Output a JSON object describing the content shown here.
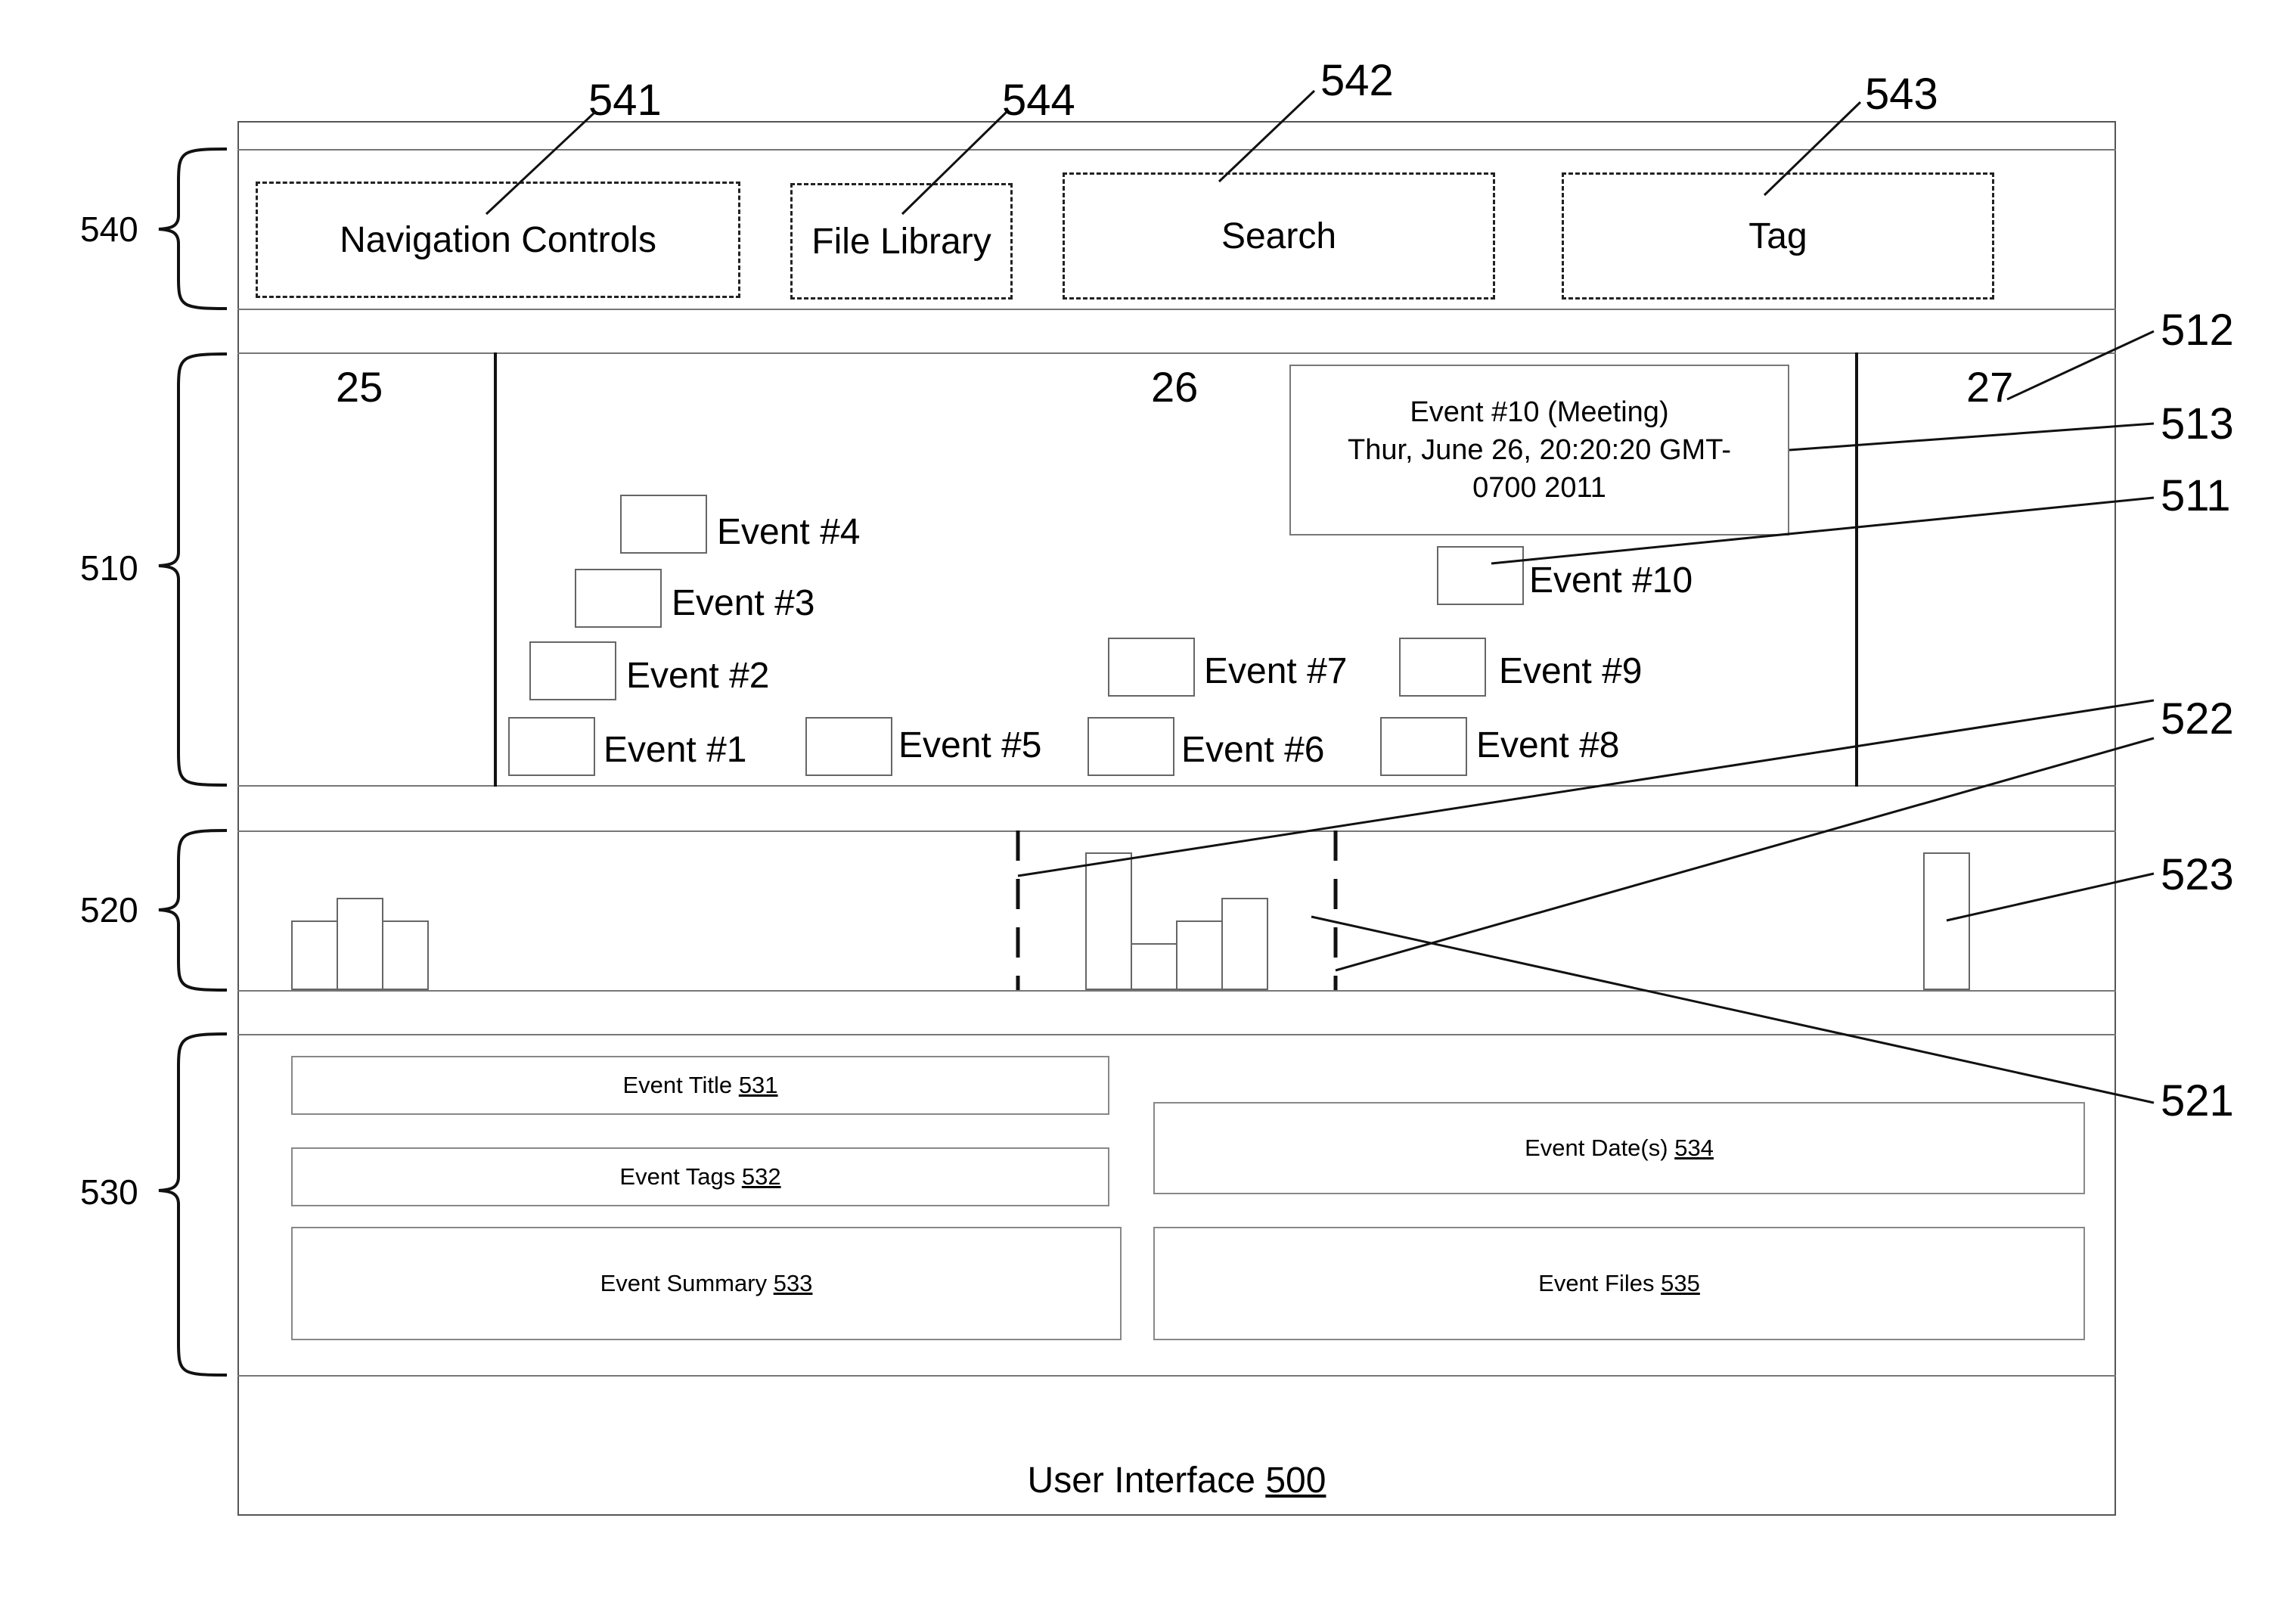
{
  "caption": {
    "label": "User Interface",
    "ref": "500"
  },
  "regions": {
    "toolbar": {
      "ref": "540"
    },
    "timeline": {
      "ref": "510"
    },
    "histogram": {
      "ref": "520"
    },
    "details": {
      "ref": "530"
    }
  },
  "toolbar": {
    "navigation": {
      "label": "Navigation Controls",
      "ref": "541"
    },
    "file_library": {
      "label": "File Library",
      "ref": "544"
    },
    "search": {
      "label": "Search",
      "ref": "542"
    },
    "tag": {
      "label": "Tag",
      "ref": "543"
    }
  },
  "timeline": {
    "days": [
      "25",
      "26",
      "27"
    ],
    "day_ref": "512",
    "event_ref": "511",
    "popup": {
      "ref": "513",
      "line1": "Event #10 (Meeting)",
      "line2": "Thur, June 26, 20:20:20 GMT-",
      "line3": "0700 2011"
    },
    "events": [
      {
        "label": "Event #1"
      },
      {
        "label": "Event #2"
      },
      {
        "label": "Event #3"
      },
      {
        "label": "Event #4"
      },
      {
        "label": "Event #5"
      },
      {
        "label": "Event #6"
      },
      {
        "label": "Event #7"
      },
      {
        "label": "Event #8"
      },
      {
        "label": "Event #9"
      },
      {
        "label": "Event #10"
      }
    ]
  },
  "histogram": {
    "selection_ref": "522",
    "bar_ref": "523",
    "cluster_ref": "521",
    "groups": [
      {
        "name": "day-25",
        "values": [
          3,
          4,
          3
        ]
      },
      {
        "name": "day-26",
        "values": [
          6,
          2,
          3,
          4
        ]
      },
      {
        "name": "day-27",
        "values": [
          6
        ]
      }
    ],
    "max_value": 6
  },
  "details": {
    "title": {
      "label": "Event Title",
      "ref": "531"
    },
    "tags": {
      "label": "Event Tags",
      "ref": "532"
    },
    "summary": {
      "label": "Event Summary",
      "ref": "533"
    },
    "dates": {
      "label": "Event Date(s)",
      "ref": "534"
    },
    "files": {
      "label": "Event Files",
      "ref": "535"
    }
  }
}
